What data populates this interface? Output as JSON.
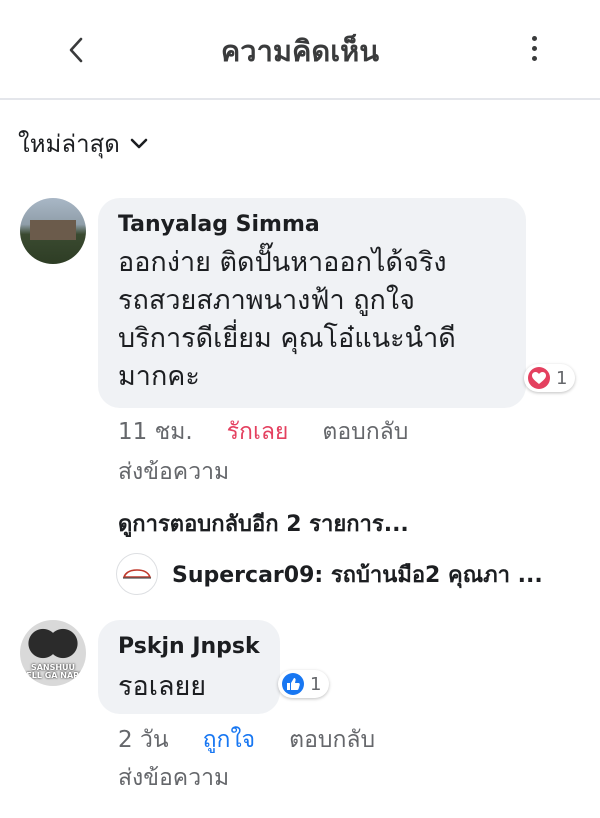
{
  "header": {
    "title": "ความคิดเห็น"
  },
  "sort": {
    "label": "ใหม่ล่าสุด"
  },
  "comments": [
    {
      "author": "Tanyalag Simma",
      "lines": [
        "ออกง่าย ติดปั๊นหาออกได้จริง",
        "รถสวยสภาพนางฟ้า ถูกใจ",
        "บริการดีเยี่ยม คุณโอ๋แนะนำดี",
        "มากคะ"
      ],
      "reaction": {
        "type": "love",
        "count": "1",
        "color": "#e4405f"
      },
      "time": "11 ชม.",
      "reacted_label": "รักเลย",
      "reply_label": "ตอบกลับ",
      "send_label": "ส่งข้อความ"
    },
    {
      "author": "Pskjn Jnpsk",
      "lines": [
        "รอเลยย"
      ],
      "reaction": {
        "type": "like",
        "count": "1",
        "color": "#1877f2"
      },
      "time": "2 วัน",
      "reacted_label": "ถูกใจ",
      "reply_label": "ตอบกลับ",
      "send_label": "ส่งข้อความ"
    }
  ],
  "view_more_replies": "ดูการตอบกลับอีก 2 รายการ...",
  "reply_preview": "Supercar09: รถบ้านมือ2 คุณภา ...",
  "avatar2_brand": "SANSHUU BELL GA NARU",
  "icons": [
    "back-icon",
    "more-icon",
    "chevron-down-icon",
    "heart-icon",
    "thumbs-up-icon"
  ]
}
